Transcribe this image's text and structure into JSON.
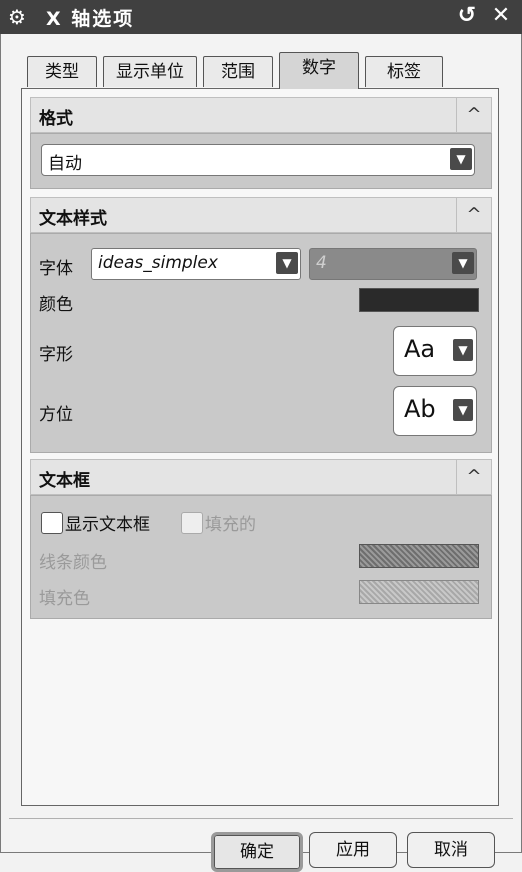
{
  "window": {
    "title": "X 轴选项",
    "gear_icon": "⚙",
    "reset_icon": "↺",
    "close_icon": "✕"
  },
  "tabs": [
    {
      "label": "类型"
    },
    {
      "label": "显示单位"
    },
    {
      "label": "范围"
    },
    {
      "label": "数字",
      "active": true
    },
    {
      "label": "标签"
    }
  ],
  "format": {
    "heading": "格式",
    "collapse_icon": "^",
    "dropdown_value": "自动",
    "dropdown_arrow": "▼"
  },
  "text_style": {
    "heading": "文本样式",
    "collapse_icon": "^",
    "font_label": "字体",
    "font_value": "ideas_simplex",
    "size_value": "4",
    "color_label": "颜色",
    "color_swatch": "#2a2a2a",
    "shape_label": "字形",
    "shape_glyph": "Aa",
    "orientation_label": "方位",
    "orientation_glyph": "Ab"
  },
  "text_box": {
    "heading": "文本框",
    "collapse_icon": "^",
    "show_box_label": "显示文本框",
    "fill_label": "填充的",
    "line_color_label": "线条颜色",
    "fill_color_label": "填充色"
  },
  "buttons": {
    "ok": "确定",
    "apply": "应用",
    "cancel": "取消"
  }
}
